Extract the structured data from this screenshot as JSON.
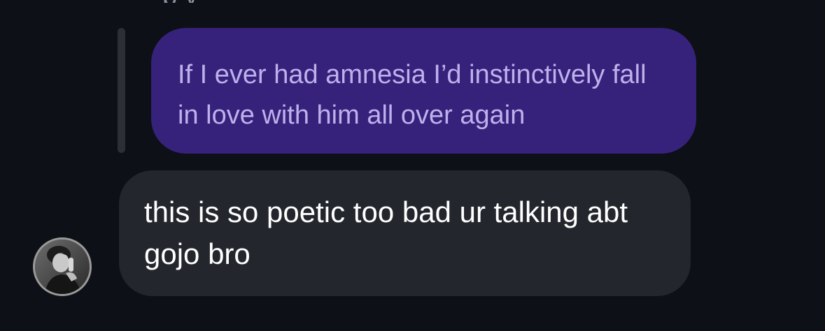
{
  "conversation": {
    "previous_message_fragment": "p       y",
    "replied_message": {
      "text": "If I ever had amnesia I’d instinctively fall in love with him all over again",
      "bubble_color": "#36227b",
      "text_color": "#bdb1ec"
    },
    "incoming_message": {
      "text": "this is so poetic too bad ur talking abt gojo bro",
      "bubble_color": "#23272d",
      "text_color": "#ffffff"
    },
    "sender": {
      "avatar_icon": "profile-photo-avatar"
    }
  },
  "theme": {
    "background": "#0d1016",
    "reply_bar": "#2c2f36"
  }
}
